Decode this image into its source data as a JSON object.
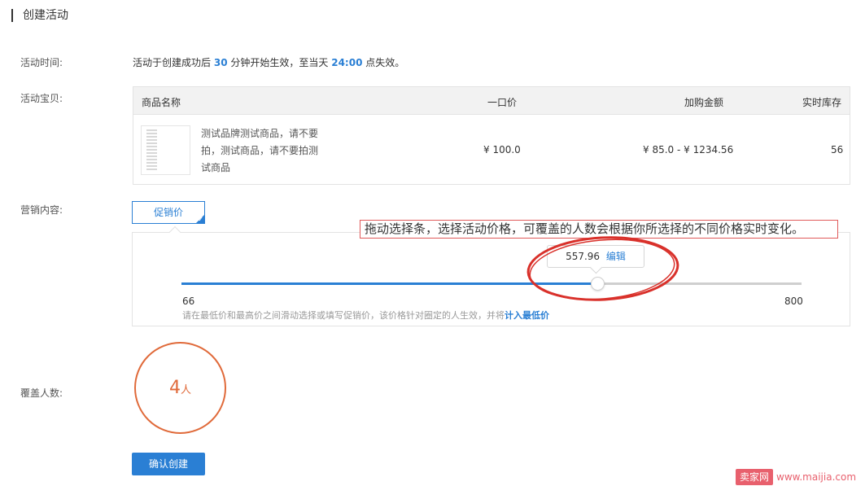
{
  "page_title": "创建活动",
  "activity_time": {
    "label": "活动时间:",
    "text_before": "活动于创建成功后",
    "minutes": "30",
    "text_middle": "分钟开始生效，至当天",
    "end_time": "24:00",
    "text_after": "点失效。"
  },
  "goods": {
    "label": "活动宝贝:",
    "columns": [
      "商品名称",
      "一口价",
      "加购金额",
      "实时库存"
    ],
    "rows": [
      {
        "name": "测试品牌测试商品，请不要拍，测试商品，请不要拍测试商品",
        "price": "¥ 100.0",
        "addon_range": "¥ 85.0 - ¥ 1234.56",
        "stock": "56"
      }
    ]
  },
  "marketing": {
    "label": "营销内容:",
    "tab_label": "促销价",
    "tab_check": "✓"
  },
  "slider": {
    "min": 66,
    "max": 800,
    "value": 557.96,
    "value_text": "557.96",
    "min_label": "66",
    "max_label": "800",
    "edit_label": "编辑",
    "hint_text": "请在最低价和最高价之间滑动选择或填写促销价，该价格针对圈定的人生效，并将",
    "hint_strong": "计入最低价"
  },
  "annotation": "拖动选择条，选择活动价格，可覆盖的人数会根据你所选择的不同价格实时变化。",
  "coverage": {
    "label": "覆盖人数:",
    "count": "4",
    "unit": "人"
  },
  "confirm_label": "确认创建",
  "watermark": {
    "brand": "卖家网",
    "url": "www.maijia.com"
  },
  "colors": {
    "accent": "#2a7fd4",
    "coverage": "#e06a3a",
    "annotation_red": "#d9312b"
  }
}
